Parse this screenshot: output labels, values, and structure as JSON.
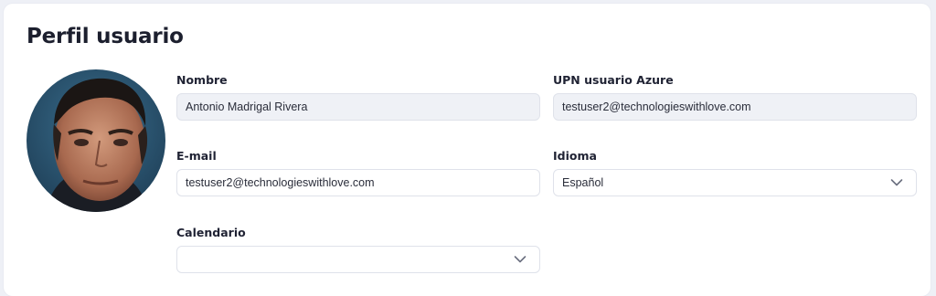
{
  "page": {
    "title": "Perfil usuario"
  },
  "profile": {
    "avatar_icon": "user-avatar-photo",
    "fields": {
      "nombre": {
        "label": "Nombre",
        "value": "Antonio Madrigal Rivera"
      },
      "upn": {
        "label": "UPN usuario Azure",
        "value": "testuser2@technologieswithlove.com"
      },
      "email": {
        "label": "E-mail",
        "value": "testuser2@technologieswithlove.com"
      },
      "idioma": {
        "label": "Idioma",
        "value": "Español",
        "icon": "chevron-down-icon"
      },
      "calendario": {
        "label": "Calendario",
        "value": "",
        "icon": "chevron-down-icon"
      }
    }
  },
  "colors": {
    "background": "#eef0f6",
    "card": "#ffffff",
    "readonly_field": "#eff1f6",
    "border": "#dfe2ea"
  }
}
